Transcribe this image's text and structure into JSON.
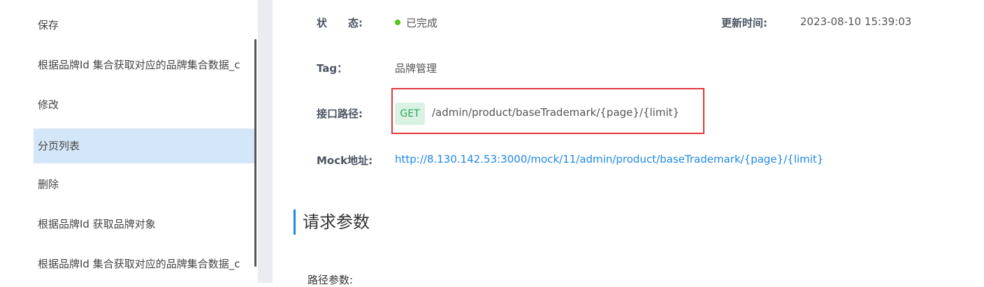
{
  "sidebar": {
    "items": [
      {
        "label": "保存"
      },
      {
        "label": "根据品牌Id 集合获取对应的品牌集合数据_c"
      },
      {
        "label": "修改"
      },
      {
        "label": "分页列表"
      },
      {
        "label": "删除"
      },
      {
        "label": "根据品牌Id 获取品牌对象"
      },
      {
        "label": "根据品牌Id 集合获取对应的品牌集合数据_c"
      }
    ],
    "active_index": 3
  },
  "detail": {
    "status_label": "状　　态:",
    "status_value": "已完成",
    "status_color": "#52c41a",
    "updated_label": "更新时间:",
    "updated_value": "2023-08-10 15:39:03",
    "tag_label": "Tag：",
    "tag_value": "品牌管理",
    "path_label": "接口路径:",
    "method": "GET",
    "path_value": "/admin/product/baseTrademark/{page}/{limit}",
    "mock_label": "Mock地址:",
    "mock_url": "http://8.130.142.53:3000/mock/11/admin/product/baseTrademark/{page}/{limit}"
  },
  "section": {
    "title": "请求参数",
    "subtitle": "路径参数:"
  },
  "colors": {
    "accent": "#1e88e5",
    "active_bg": "#d4e7f9",
    "highlight": "#e0373a",
    "method_bg": "#d9f2e3",
    "method_text": "#2fa55b"
  }
}
